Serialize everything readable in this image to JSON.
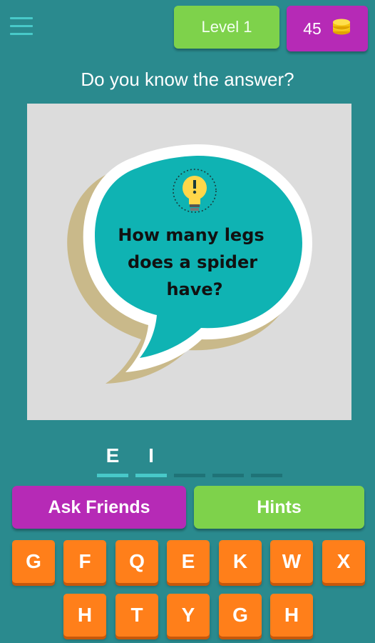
{
  "header": {
    "level_label": "Level 1",
    "coins": "45",
    "coin_icon": "coin-stack-icon",
    "menu_icon": "hamburger-menu-icon"
  },
  "prompt": "Do you know the answer?",
  "question_image": {
    "lines": [
      "How many legs",
      "does a spider",
      "have?"
    ],
    "icon": "lightbulb-icon"
  },
  "answer_slots": [
    "E",
    "I",
    "",
    "",
    ""
  ],
  "buttons": {
    "ask_friends": "Ask Friends",
    "hints": "Hints"
  },
  "keyboard": {
    "row1": [
      "G",
      "F",
      "Q",
      "E",
      "K",
      "W",
      "X"
    ],
    "row2": [
      "H",
      "T",
      "Y",
      "G",
      "H"
    ]
  },
  "colors": {
    "background": "#2a8a8e",
    "level_green": "#7ed24b",
    "coins_purple": "#b62ab6",
    "key_orange": "#ff7f1a",
    "bubble_teal": "#0fb3b3"
  }
}
